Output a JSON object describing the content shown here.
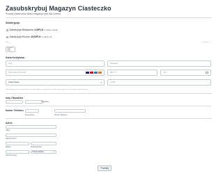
{
  "header": {
    "title": "Zasubskrybuj Magazyn Ciasteczko",
    "subtitle": "Poznaj ciasteczka! Nasz magazyn jest dla Ciebie!"
  },
  "subscription": {
    "label": "Subskrypcja",
    "options": [
      {
        "label": "Subskrypcja Miesięczna",
        "price": "4,00PLN",
        "suffix": "co każdy miesiąc"
      },
      {
        "label": "Subskrypcja Roczna",
        "price": "40,00PLN",
        "suffix": "co każdy rok"
      }
    ],
    "left_hint": "Kod",
    "right_hint": "Zastosuj"
  },
  "total": {
    "label": "Łącznie",
    "value": "0,00 PLN"
  },
  "card": {
    "label": "Karta Kredytowa",
    "first_name_placeholder": "Imię",
    "last_name_placeholder": "Nazwisko",
    "number_placeholder": "1234 1234 1234 1234",
    "expiry_placeholder": "MM / YY",
    "cvc_placeholder": "CVC",
    "country": "United States",
    "zip_placeholder": "12345",
    "disclaimer": "By providing your card information, you allow Stripe to charge your card for future payments in accordance with their terms."
  },
  "name": {
    "label": "Imię i Nazwisko",
    "first_sub": "Imię",
    "last_sub": "Nazwisko"
  },
  "phone": {
    "label": "Numer Telefonu",
    "area_sub": "Kierunkowy",
    "number_sub": "Numer Telefonu"
  },
  "address": {
    "label": "Adres",
    "street_sub": "Ulica",
    "street2_sub": "Numer Domu",
    "city_sub": "Miasto",
    "region_sub": "Województwo",
    "zip_sub": "Kod Pocztowy",
    "select_value": "Proszę Wybrać"
  },
  "submit": {
    "label": "Prześlij"
  },
  "colors": {
    "visa": "#1a1f71",
    "mastercard": "#eb001b",
    "amex": "#2e77bc",
    "discover": "#f47216"
  }
}
